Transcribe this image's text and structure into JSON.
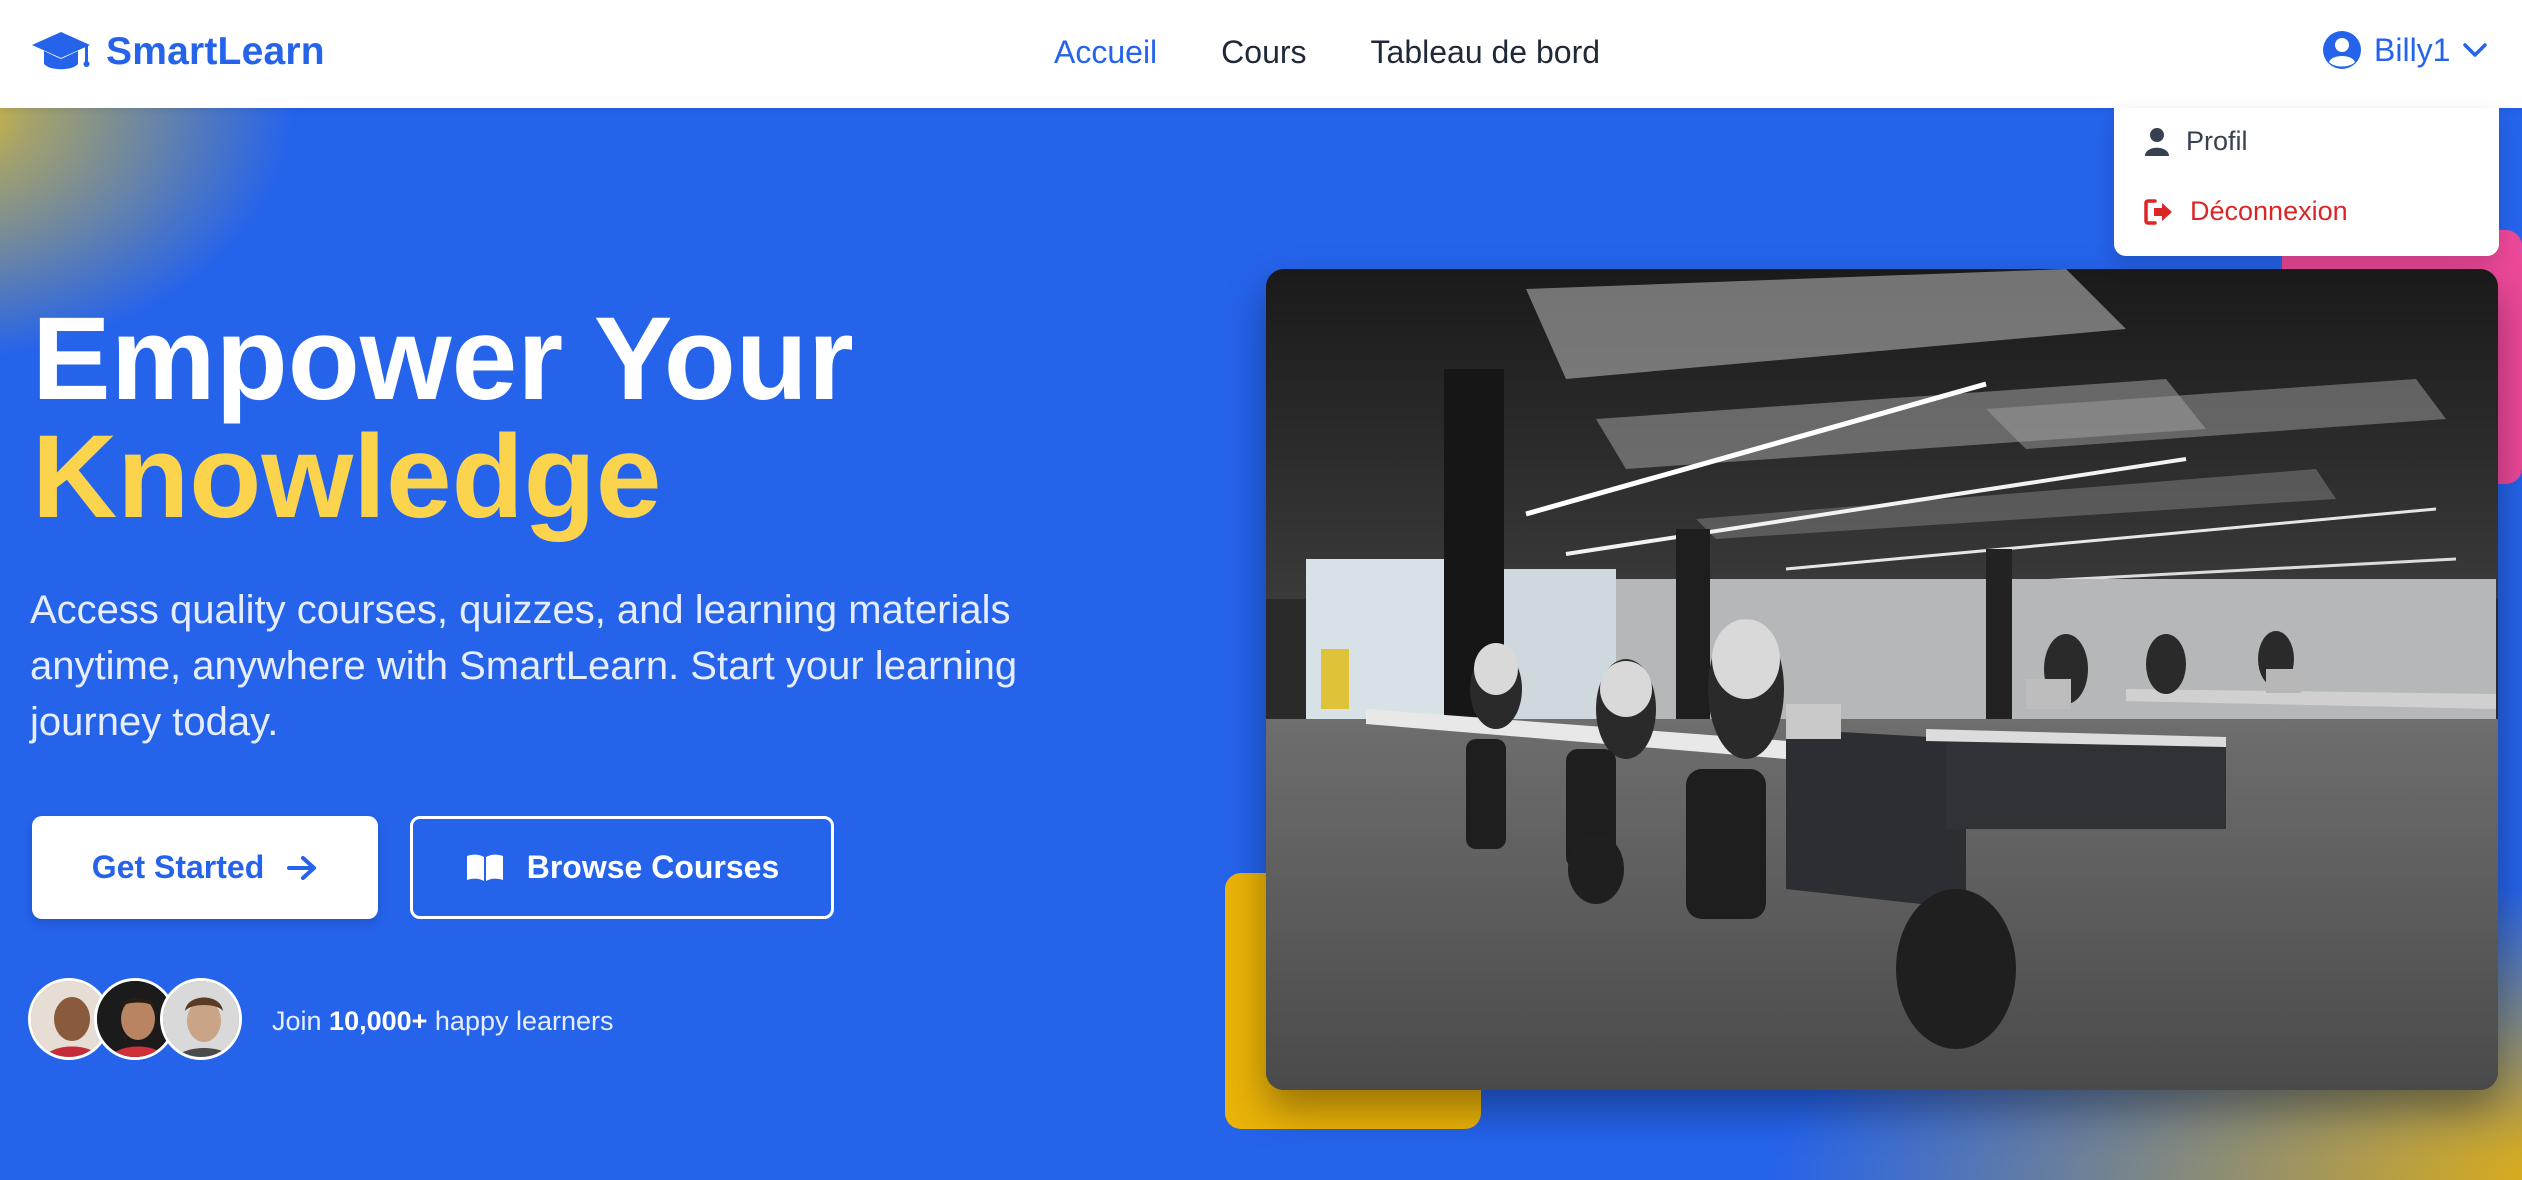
{
  "brand": {
    "name": "SmartLearn",
    "icon": "graduation-cap-icon"
  },
  "nav": {
    "items": [
      {
        "label": "Accueil",
        "active": true
      },
      {
        "label": "Cours",
        "active": false
      },
      {
        "label": "Tableau de bord",
        "active": false
      }
    ]
  },
  "user": {
    "name": "Billy1"
  },
  "dropdown": {
    "items": [
      {
        "label": "Profil",
        "icon": "user-icon"
      },
      {
        "label": "Déconnexion",
        "icon": "logout-icon"
      }
    ]
  },
  "hero": {
    "headline_line1": "Empower Your",
    "headline_line2": "Knowledge",
    "subtitle": "Access quality courses, quizzes, and learning materials anytime, anywhere with SmartLearn. Start your learning journey today.",
    "primary_button": "Get Started",
    "secondary_button": "Browse Courses",
    "join_prefix": "Join ",
    "join_count": "10,000+",
    "join_suffix": " happy learners"
  },
  "colors": {
    "primary": "#2563eb",
    "accent_yellow": "#fcd34d",
    "danger": "#dc2626",
    "pink": "#ec4899",
    "deco_yellow": "#eab308"
  }
}
